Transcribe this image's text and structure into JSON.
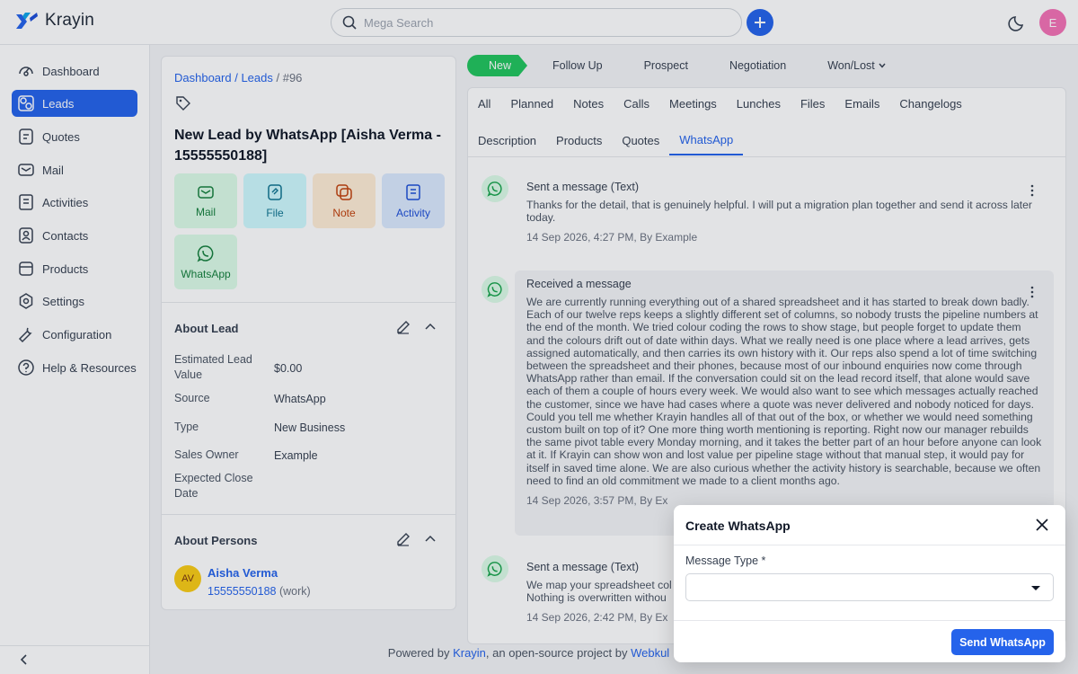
{
  "app": {
    "name": "Krayin"
  },
  "search": {
    "placeholder": "Mega Search"
  },
  "user": {
    "initial": "E"
  },
  "sidebar": {
    "items": [
      {
        "label": "Dashboard",
        "icon": "dashboard-icon"
      },
      {
        "label": "Leads",
        "icon": "leads-icon",
        "active": true
      },
      {
        "label": "Quotes",
        "icon": "quotes-icon"
      },
      {
        "label": "Mail",
        "icon": "mail-icon"
      },
      {
        "label": "Activities",
        "icon": "activities-icon"
      },
      {
        "label": "Contacts",
        "icon": "contacts-icon"
      },
      {
        "label": "Products",
        "icon": "products-icon"
      },
      {
        "label": "Settings",
        "icon": "settings-icon"
      },
      {
        "label": "Configuration",
        "icon": "configuration-icon"
      },
      {
        "label": "Help & Resources",
        "icon": "help-icon"
      }
    ]
  },
  "breadcrumb": {
    "dashboard": "Dashboard",
    "sep": " / ",
    "leads": "Leads",
    "current": " / #96"
  },
  "lead": {
    "title": "New Lead by WhatsApp [Aisha Verma - 15555550188]"
  },
  "actions": [
    {
      "label": "Mail",
      "bg": "#dcfce7",
      "color": "#15803d"
    },
    {
      "label": "File",
      "bg": "#cffafe",
      "color": "#0e7490"
    },
    {
      "label": "Note",
      "bg": "#ffedd5",
      "color": "#c2410c"
    },
    {
      "label": "Activity",
      "bg": "#dbeafe",
      "color": "#1d4ed8"
    },
    {
      "label": "WhatsApp",
      "bg": "#dcfce7",
      "color": "#15803d"
    }
  ],
  "about_lead": {
    "title": "About Lead",
    "fields": [
      {
        "label": "Estimated Lead Value",
        "value": "$0.00"
      },
      {
        "label": "Source",
        "value": "WhatsApp"
      },
      {
        "label": "Type",
        "value": "New Business"
      },
      {
        "label": "Sales Owner",
        "value": "Example"
      },
      {
        "label": "Expected Close Date",
        "value": ""
      }
    ]
  },
  "about_persons": {
    "title": "About Persons",
    "person": {
      "initials": "AV",
      "name": "Aisha Verma",
      "phone": "15555550188",
      "phone_type": "(work)"
    }
  },
  "stages": [
    "New",
    "Follow Up",
    "Prospect",
    "Negotiation",
    "Won/Lost"
  ],
  "tabs_row1": [
    "All",
    "Planned",
    "Notes",
    "Calls",
    "Meetings",
    "Lunches",
    "Files",
    "Emails",
    "Changelogs"
  ],
  "tabs_row2": [
    "Description",
    "Products",
    "Quotes",
    "WhatsApp"
  ],
  "active_tab": "WhatsApp",
  "messages": [
    {
      "title": "Sent a message (Text)",
      "text": "Thanks for the detail, that is genuinely helpful. I will put a migration plan together and send it across later today.",
      "meta": "14 Sep 2026, 4:27 PM, By Example"
    },
    {
      "title": "Received a message",
      "text": "We are currently running everything out of a shared spreadsheet and it has started to break down badly. Each of our twelve reps keeps a slightly different set of columns, so nobody trusts the pipeline numbers at the end of the month. We tried colour coding the rows to show stage, but people forget to update them and the colours drift out of date within days. What we really need is one place where a lead arrives, gets assigned automatically, and then carries its own history with it. Our reps also spend a lot of time switching between the spreadsheet and their phones, because most of our inbound enquiries now come through WhatsApp rather than email. If the conversation could sit on the lead record itself, that alone would save each of them a couple of hours every week. We would also want to see which messages actually reached the customer, since we have had cases where a quote was never delivered and nobody noticed for days. Could you tell me whether Krayin handles all of that out of the box, or whether we would need something custom built on top of it? One more thing worth mentioning is reporting. Right now our manager rebuilds the same pivot table every Monday morning, and it takes the better part of an hour before anyone can look at it. If Krayin can show won and lost value per pipeline stage without that manual step, it would pay for itself in saved time alone. We are also curious whether the activity history is searchable, because we often need to find an old commitment we made to a client months ago.",
      "meta": "14 Sep 2026, 3:57 PM, By Ex"
    },
    {
      "title": "Sent a message (Text)",
      "text": "We map your spreadsheet col\nNothing is overwritten withou",
      "meta": "14 Sep 2026, 2:42 PM, By Ex"
    }
  ],
  "footer": {
    "prefix": "Powered by ",
    "krayin": "Krayin",
    "middle": ", an open-source project by ",
    "webkul": "Webkul"
  },
  "modal": {
    "title": "Create WhatsApp",
    "field_label": "Message Type *",
    "selected": "",
    "submit": "Send WhatsApp"
  },
  "colors": {
    "primary": "#2563eb",
    "stage_active": "#22c55e",
    "whatsapp": "#16a34a"
  }
}
